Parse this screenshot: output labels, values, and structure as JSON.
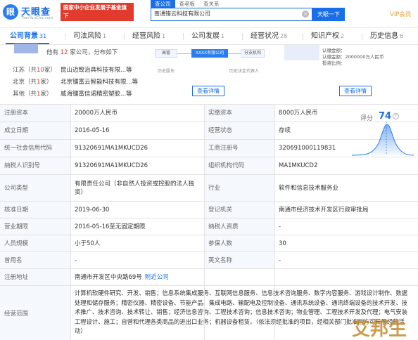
{
  "header": {
    "logo_mark": "眼",
    "logo_text": "天眼查",
    "logo_sub": "TianYanCha.com",
    "cert_line1": "国家中小企业发展子基金旗下",
    "cert_line2": "官方备案企业征信机构",
    "search_tabs": [
      "查公司",
      "查老板",
      "查关系"
    ],
    "search_value": "南通错云科技有限公司",
    "search_button": "天眼一下",
    "clear_glyph": "×",
    "vip": "VIP会员"
  },
  "tabs": [
    {
      "label": "公司背景",
      "count": "31",
      "active": true
    },
    {
      "label": "司法风险",
      "count": "1"
    },
    {
      "label": "经营风险",
      "count": "1"
    },
    {
      "label": "公司发展",
      "count": "1"
    },
    {
      "label": "经营状况",
      "count": "28"
    },
    {
      "label": "知识产权",
      "count": "2"
    },
    {
      "label": "历史信息",
      "count": "6"
    }
  ],
  "summary": {
    "avatar": "",
    "head_prefix": "他有",
    "head_count": "12",
    "head_suffix": "家公司，分布如下",
    "regions": [
      {
        "region": "江苏（共",
        "count": "10",
        "unit": "家）",
        "name": "昆山迈致治具科技有限...等"
      },
      {
        "region": "北京（共",
        "count": "1",
        "unit": "家）",
        "name": "北京镭富云智能科技有限...等"
      },
      {
        "region": "其他（共",
        "count": "1",
        "unit": "家）",
        "name": "威海镭富信诺精密塑胶...等"
      }
    ]
  },
  "diagram": {
    "left_node": "高管",
    "center_node": "XXXX有限公司",
    "right_node": "分支机构",
    "note_left": "历史股东",
    "note_right": "历史法定代表人",
    "view_button": "查看详情"
  },
  "right_card": {
    "line1": "认缴金额：",
    "line2": "认缴金额：2000000万人民币",
    "line3": "投资比例：",
    "view_button": "查看详情"
  },
  "score": {
    "label": "评分",
    "value": "74",
    "help": "?"
  },
  "table": {
    "rows": [
      {
        "l1": "注册资本",
        "v1": "20000万人民币",
        "l2": "实缴资本",
        "v2": "8000万人民币"
      },
      {
        "l1": "成立日期",
        "v1": "2016-05-16",
        "l2": "经营状态",
        "v2": "存续"
      },
      {
        "l1": "统一社会信用代码",
        "v1": "91320691MA1MKUCD26",
        "l2": "工商注册号",
        "v2": "320691000119831"
      },
      {
        "l1": "纳税人识别号",
        "v1": "91320691MA1MKUCD26",
        "l2": "组织机构代码",
        "v2": "MA1MKUCD2"
      },
      {
        "l1": "公司类型",
        "v1": "有限责任公司（非自然人投资或控股的法人独资）",
        "l2": "行业",
        "v2": "软件和信息技术服务业"
      },
      {
        "l1": "核准日期",
        "v1": "2019-06-30",
        "l2": "登记机关",
        "v2": "南通市经济技术开发区行政审批局"
      },
      {
        "l1": "营业期限",
        "v1": "2016-05-16至无固定期限",
        "l2": "纳税人资质",
        "v2": "-"
      },
      {
        "l1": "人员规模",
        "v1": "小于50人",
        "l2": "参保人数",
        "v2": "30"
      },
      {
        "l1": "曾用名",
        "v1": "-",
        "l2": "英文名称",
        "v2": "-"
      }
    ],
    "address_label": "注册地址",
    "address_value": "南通市开发区中央路69号",
    "address_link": "附近公司",
    "scope_label": "经营范围",
    "scope_value": "计算机软硬件研究、开发、销售；信息系统集成服务、互联网信息服务、信息技术咨询服务、数字内容服务、游戏设计制作、数据处理和储存服务；精密仪器、精密设备、节能产品、集成电路、输配电及控制设备、通讯系统设备、通讯终端设备的技术开发、技术推广、技术咨询、技术转让、销售；经济信息咨询、工程技术咨询；信息技术咨询；物业管理、工程技术开发及代理；电气安装工程设计、施工；自营和代理各类商品的进出口业务；机器设备租赁。（依法须经批准的项目，经相关部门批准后方可开展经营活动）"
  },
  "watermark": "艾邦生"
}
